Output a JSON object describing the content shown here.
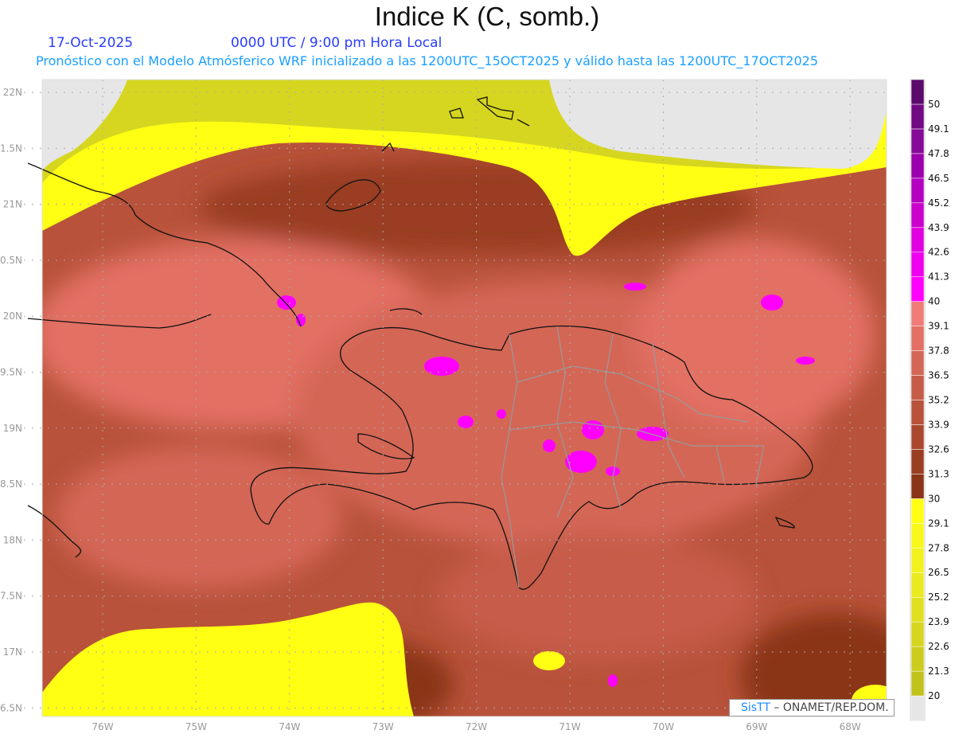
{
  "header": {
    "title": "Indice K (C, somb.)",
    "date": "17-Oct-2025",
    "time": "0000 UTC / 9:00 pm Hora Local",
    "subtitle": "Pronóstico con el Modelo Atmósferico WRF inicializado a las 1200UTC_15OCT2025 y válido hasta las  1200UTC_17OCT2025"
  },
  "axes": {
    "lon_labels": [
      "76W",
      "75W",
      "74W",
      "73W",
      "72W",
      "71W",
      "70W",
      "69W",
      "68W"
    ],
    "lat_labels": [
      "22N",
      "1.5N",
      "21N",
      "0.5N",
      "20N",
      "9.5N",
      "19N",
      "8.5N",
      "18N",
      "7.5N",
      "17N",
      "6.5N"
    ]
  },
  "colorbar": {
    "labels": [
      "20",
      "21.3",
      "22.6",
      "23.9",
      "25.2",
      "26.5",
      "27.8",
      "29.1",
      "30",
      "31.3",
      "32.6",
      "33.9",
      "35.2",
      "36.5",
      "37.8",
      "39.1",
      "40",
      "41.3",
      "42.6",
      "43.9",
      "45.2",
      "46.5",
      "47.8",
      "49.1",
      "50"
    ],
    "colors": [
      "#e6e6e6",
      "#c2c21c",
      "#cccc1e",
      "#d6d620",
      "#e0e020",
      "#eaea20",
      "#f2f21e",
      "#f8f81a",
      "#ffff14",
      "#8a3418",
      "#9a3e22",
      "#aa482e",
      "#b8523a",
      "#c65c48",
      "#d46656",
      "#e27064",
      "#f07c78",
      "#ff00ff",
      "#ee00ee",
      "#e000e0",
      "#cc00cc",
      "#b400c0",
      "#9c00ac",
      "#860a98",
      "#720a84",
      "#5c0a6c"
    ]
  },
  "credit": {
    "brand": "SisTT",
    "org": " –  ONAMET/REP.DOM."
  }
}
